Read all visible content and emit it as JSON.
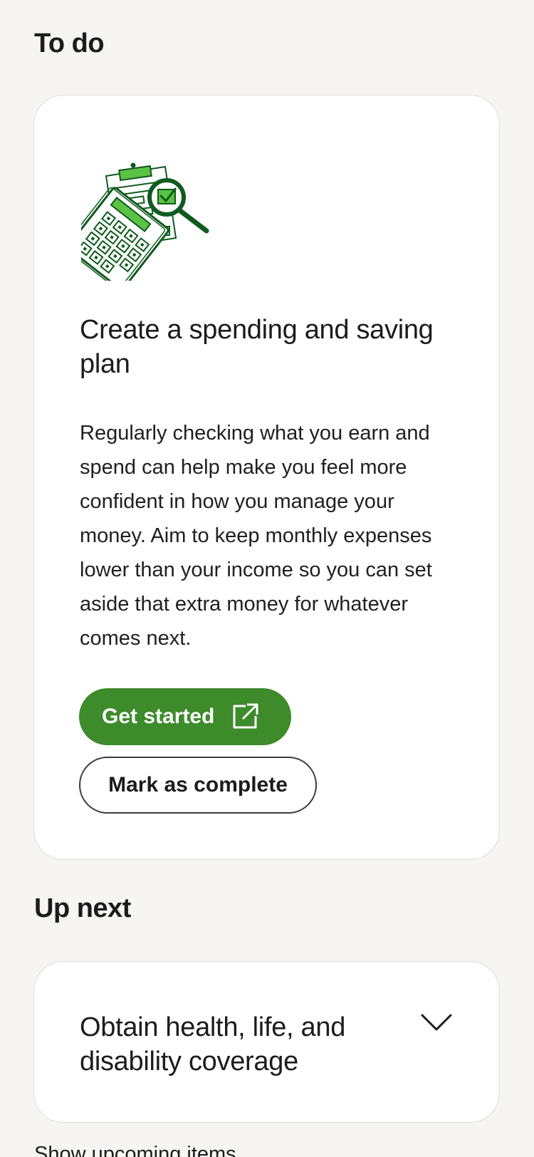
{
  "todo": {
    "heading": "To do",
    "card": {
      "illustration_icon": "budget-calculator-magnifier-icon",
      "title": "Create a spending and saving plan",
      "body": "Regularly checking what you earn and spend can help make you feel more confident in how you manage your money. Aim to keep monthly expenses lower than your income so you can set aside that extra money for whatever comes next.",
      "primary_button": {
        "label": "Get started",
        "icon": "external-link-icon"
      },
      "secondary_button": {
        "label": "Mark as complete"
      }
    }
  },
  "up_next": {
    "heading": "Up next",
    "items": [
      {
        "title": "Obtain health, life, and disability coverage",
        "icon": "chevron-down-icon"
      }
    ]
  },
  "footer_partial_text": "Show upcoming items",
  "colors": {
    "accent_green": "#3d8b2a",
    "dark_green": "#0f5a1e",
    "light_green": "#5cc243",
    "background": "#f6f5f3",
    "card": "#ffffff"
  }
}
